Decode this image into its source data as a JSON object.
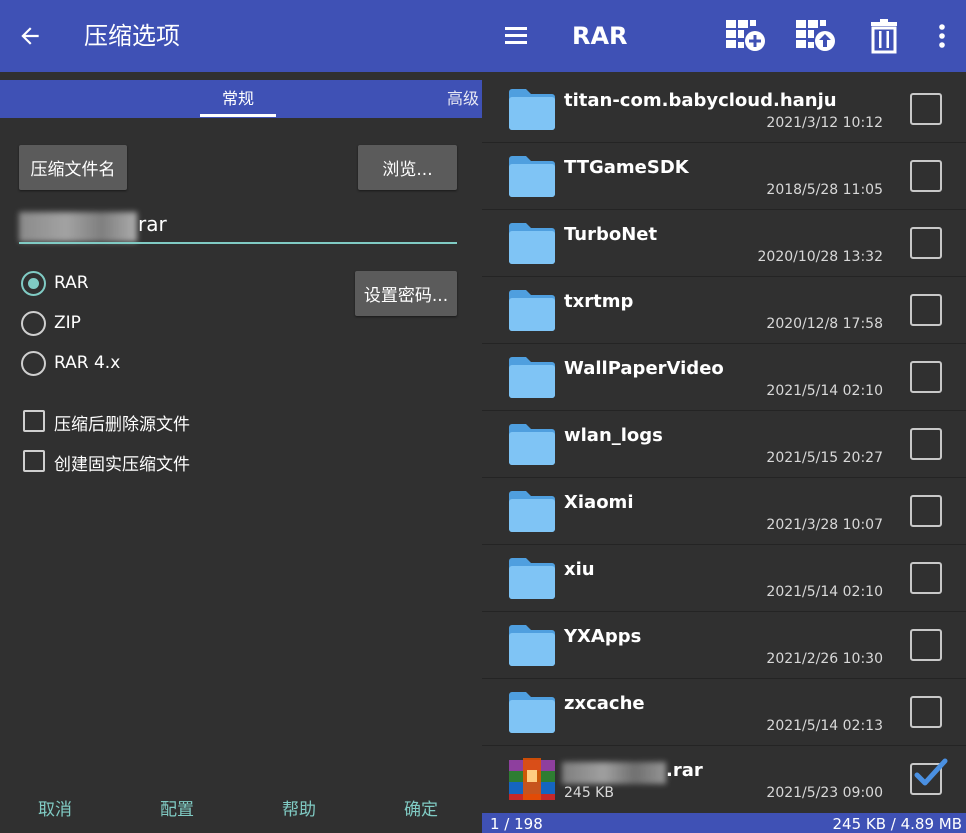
{
  "left": {
    "title": "压缩选项",
    "tabs": [
      {
        "label": "常规",
        "active": true
      },
      {
        "label": "高级",
        "active": false
      }
    ],
    "archive_name_button": "压缩文件名",
    "browse_button": "浏览...",
    "filename_suffix": "rar",
    "set_password_button": "设置密码...",
    "formats": [
      {
        "label": "RAR",
        "selected": true
      },
      {
        "label": "ZIP",
        "selected": false
      },
      {
        "label": "RAR 4.x",
        "selected": false
      }
    ],
    "options": [
      {
        "label": "压缩后删除源文件",
        "checked": false
      },
      {
        "label": "创建固实压缩文件",
        "checked": false
      }
    ],
    "actions": {
      "cancel": "取消",
      "profiles": "配置",
      "help": "帮助",
      "ok": "确定"
    }
  },
  "right": {
    "title": "RAR",
    "files": [
      {
        "name": "titan-com.babycloud.hanju",
        "date": "2021/3/12 10:12",
        "type": "folder",
        "checked": false
      },
      {
        "name": "TTGameSDK",
        "date": "2018/5/28 11:05",
        "type": "folder",
        "checked": false
      },
      {
        "name": "TurboNet",
        "date": "2020/10/28 13:32",
        "type": "folder",
        "checked": false
      },
      {
        "name": "txrtmp",
        "date": "2020/12/8 17:58",
        "type": "folder",
        "checked": false
      },
      {
        "name": "WallPaperVideo",
        "date": "2021/5/14 02:10",
        "type": "folder",
        "checked": false
      },
      {
        "name": "wlan_logs",
        "date": "2021/5/15 20:27",
        "type": "folder",
        "checked": false
      },
      {
        "name": "Xiaomi",
        "date": "2021/3/28 10:07",
        "type": "folder",
        "checked": false
      },
      {
        "name": "xiu",
        "date": "2021/5/14 02:10",
        "type": "folder",
        "checked": false
      },
      {
        "name": "YXApps",
        "date": "2021/2/26 10:30",
        "type": "folder",
        "checked": false
      },
      {
        "name": "zxcache",
        "date": "2021/5/14 02:13",
        "type": "folder",
        "checked": false
      }
    ],
    "archive_file": {
      "name_suffix": ".rar",
      "size": "245 KB",
      "date": "2021/5/23 09:00",
      "checked": true
    },
    "status": {
      "count": "1 / 198",
      "size": "245 KB / 4.89 MB"
    }
  },
  "colors": {
    "appbar": "#3f51b5",
    "accent": "#80cbc4",
    "background": "#303030",
    "folder": "#64b5f6"
  }
}
